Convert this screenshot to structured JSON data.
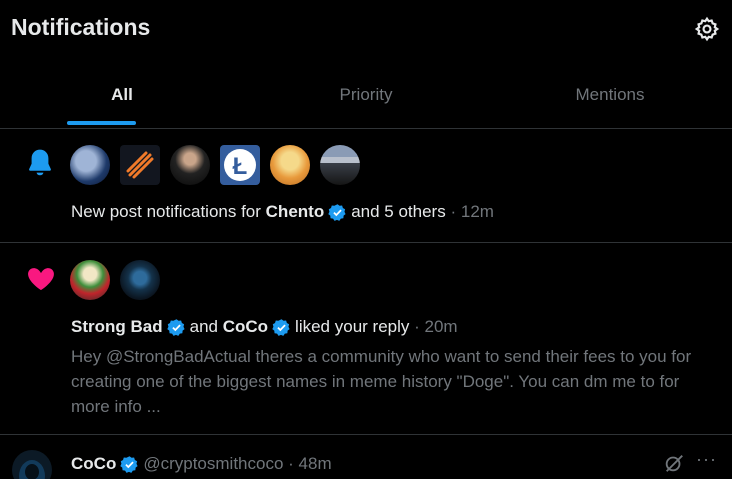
{
  "header": {
    "title": "Notifications",
    "settings_icon": "gear-icon"
  },
  "tabs": [
    {
      "label": "All",
      "active": true
    },
    {
      "label": "Priority",
      "active": false
    },
    {
      "label": "Mentions",
      "active": false
    }
  ],
  "accent_color": "#1d9bf0",
  "notifications": [
    {
      "type": "new-post",
      "icon": "bell-icon",
      "text_prefix": "New post notifications for",
      "user": "Chento",
      "text_suffix": "and 5 others",
      "separator": "·",
      "time": "12m"
    },
    {
      "type": "like",
      "icon": "heart-icon",
      "user1": "Strong Bad",
      "conj": "and",
      "user2": "CoCo",
      "action": "liked your reply",
      "separator": "·",
      "time": "20m",
      "body": "Hey @StrongBadActual theres a community who want to send their fees to you for creating one of the biggest names in meme history \"Doge\". You can dm me to for more info ..."
    },
    {
      "type": "post",
      "user": "CoCo",
      "handle": "@cryptosmithcoco",
      "separator": "·",
      "time": "48m",
      "actions": {
        "grok_icon": "grok-icon",
        "more": "···"
      }
    }
  ]
}
